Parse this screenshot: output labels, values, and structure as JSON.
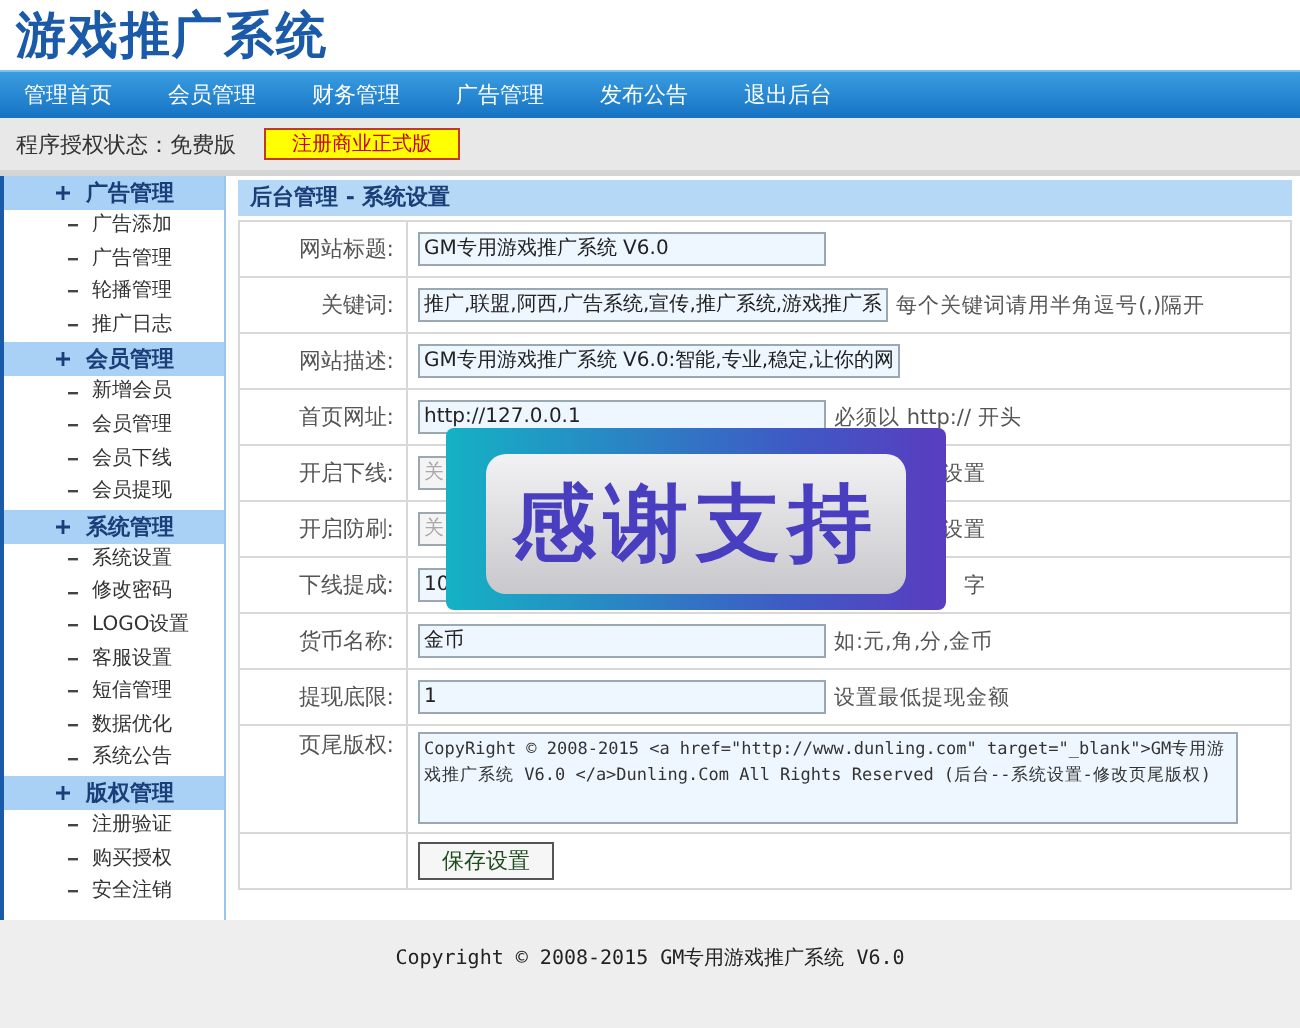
{
  "logo": "游戏推广系统",
  "nav": [
    {
      "label": "管理首页"
    },
    {
      "label": "会员管理"
    },
    {
      "label": "财务管理"
    },
    {
      "label": "广告管理"
    },
    {
      "label": "发布公告"
    },
    {
      "label": "退出后台"
    }
  ],
  "license": {
    "label": "程序授权状态：免费版",
    "button": "注册商业正式版"
  },
  "sidebar": [
    {
      "label": "广告管理",
      "children": [
        {
          "label": "广告添加"
        },
        {
          "label": "广告管理"
        },
        {
          "label": "轮播管理"
        },
        {
          "label": "推广日志"
        }
      ]
    },
    {
      "label": "会员管理",
      "children": [
        {
          "label": "新增会员"
        },
        {
          "label": "会员管理"
        },
        {
          "label": "会员下线"
        },
        {
          "label": "会员提现"
        }
      ]
    },
    {
      "label": "系统管理",
      "children": [
        {
          "label": "系统设置"
        },
        {
          "label": "修改密码"
        },
        {
          "label": "LOGO设置"
        },
        {
          "label": "客服设置"
        },
        {
          "label": "短信管理"
        },
        {
          "label": "数据优化"
        },
        {
          "label": "系统公告"
        }
      ]
    },
    {
      "label": "版权管理",
      "children": [
        {
          "label": "注册验证"
        },
        {
          "label": "购买授权"
        },
        {
          "label": "安全注销"
        }
      ]
    }
  ],
  "panel_title": "后台管理 - 系统设置",
  "form": [
    {
      "kind": "text",
      "label": "网站标题:",
      "value": "GM专用游戏推广系统 V6.0"
    },
    {
      "kind": "text",
      "label": "关键词:",
      "value": "推广,联盟,阿西,广告系统,宣传,推广系统,游戏推广系",
      "hint": "每个关键词请用半角逗号(,)隔开"
    },
    {
      "kind": "text",
      "label": "网站描述:",
      "value": "GM专用游戏推广系统 V6.0:智能,专业,稳定,让你的网"
    },
    {
      "kind": "text",
      "label": "首页网址:",
      "value": "http://127.0.0.1",
      "hint": "必须以 http:// 开头"
    },
    {
      "kind": "text",
      "label": "开启下线:",
      "value": "关",
      "hint_tail": "设置",
      "disabled": true
    },
    {
      "kind": "text",
      "label": "开启防刷:",
      "value": "关",
      "hint_tail": "设置",
      "disabled": true
    },
    {
      "kind": "text",
      "label": "下线提成:",
      "value": "10",
      "hint_tail": "字"
    },
    {
      "kind": "text",
      "label": "货币名称:",
      "value": "金币",
      "hint": "如:元,角,分,金币"
    },
    {
      "kind": "text",
      "label": "提现底限:",
      "value": "1",
      "hint": "设置最低提现金额"
    },
    {
      "kind": "textarea",
      "label": "页尾版权:",
      "value": "CopyRight © 2008-2015 <a href=\"http://www.dunling.com\" target=\"_blank\">GM专用游戏推广系统 V6.0 </a>Dunling.Com All Rights Reserved (后台--系统设置-修改页尾版权)"
    }
  ],
  "save_button": "保存设置",
  "footer": "Copyright © 2008-2015 GM专用游戏推广系统 V6.0",
  "overlay": {
    "text": "感谢支持"
  }
}
